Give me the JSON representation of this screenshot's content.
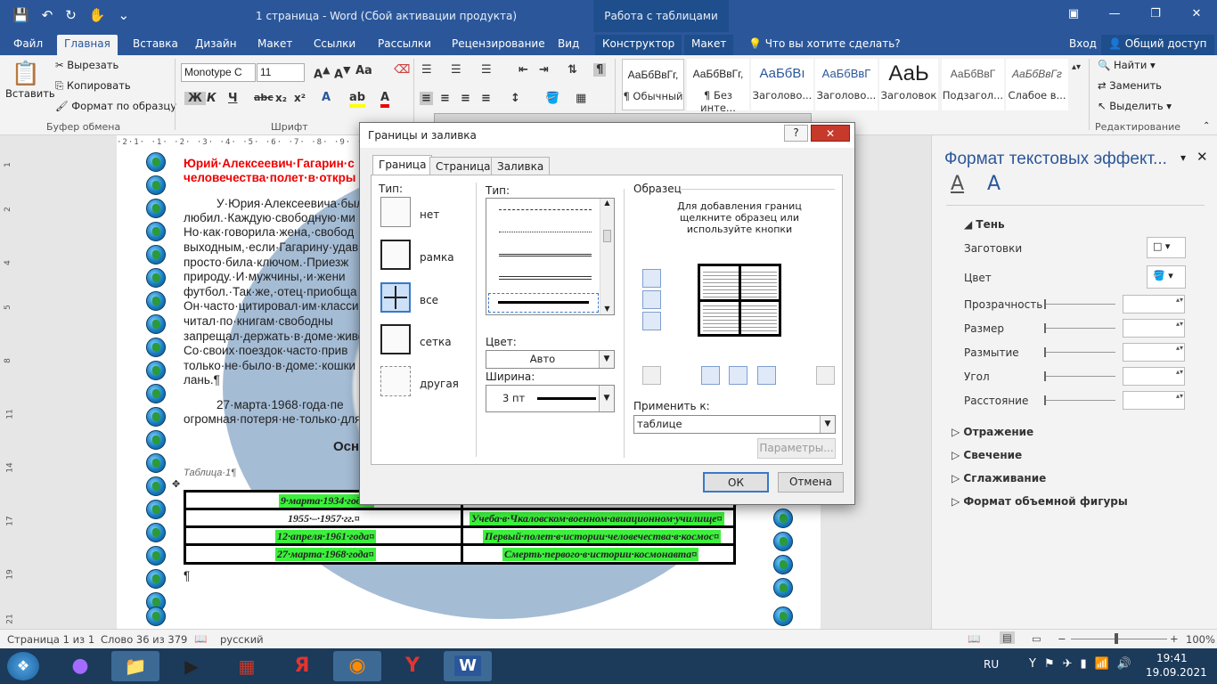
{
  "window": {
    "title": "1 страница - Word (Сбой активации продукта)",
    "context_title": "Работа с таблицами",
    "login": "Вход",
    "share": "Общий доступ"
  },
  "tabs": [
    "Файл",
    "Главная",
    "Вставка",
    "Дизайн",
    "Макет",
    "Ссылки",
    "Рассылки",
    "Рецензирование",
    "Вид",
    "Конструктор",
    "Макет"
  ],
  "tell_me": "Что вы хотите сделать?",
  "ribbon": {
    "paste": "Вставить",
    "cut": "Вырезать",
    "copy": "Копировать",
    "format_painter": "Формат по образцу",
    "clipboard_group": "Буфер обмена",
    "font_name": "Monotype C",
    "font_size": "11",
    "font_group": "Шрифт",
    "styles": [
      {
        "preview": "АаБбВвГг,",
        "name": "¶ Обычный"
      },
      {
        "preview": "АаБбВвГг,",
        "name": "¶ Без инте..."
      },
      {
        "preview": "АаБбВı",
        "name": "Заголово..."
      },
      {
        "preview": "АаБбВвГ",
        "name": "Заголово..."
      },
      {
        "preview": "АаЬ",
        "name": "Заголовок"
      },
      {
        "preview": "АаБбВвГ",
        "name": "Подзагол..."
      },
      {
        "preview": "АаБбВвГг",
        "name": "Слабое в..."
      }
    ],
    "find": "Найти",
    "replace": "Заменить",
    "select": "Выделить",
    "editing_group": "Редактирование"
  },
  "document": {
    "heading_line1": "Юрий·Алексеевич·Гагарин·с",
    "heading_line2": "человечества·полет·в·откры",
    "lines": [
      "У·Юрия·Алексеевича·был",
      "любил.·Каждую·свободную·ми",
      "Но·как·говорила·жена,·свобод",
      "выходным,·если·Гагарину·удав",
      "просто·била·ключом.·Приезж",
      "природу.·И·мужчины,·и·жени",
      "футбол.·Так·же,·отец·приобща",
      "Он·часто·цитировал·им·класси",
      "читал·по·книгам·свободны",
      "запрещал·держать·в·доме·живо",
      "Со·своих·поездок·часто·прив",
      "только·не·было·в·доме:·кошки",
      "лань.¶"
    ],
    "para2_line1": "27·марта·1968·года·пе",
    "para2_line2": "огромная·потеря·не·только·для",
    "table_heading": "Осн",
    "table_caption": "Таблица·1¶",
    "table_rows": [
      {
        "date": "9·марта·1934·года¤",
        "event": ""
      },
      {
        "date": "1955·–·1957·гг.¤",
        "event": "Учеба·в·Чкаловском·военном·авиационном·училище¤"
      },
      {
        "date": "12·апреля·1961·года¤",
        "event": "Первый·полет·в·истории·человечества·в·космос¤"
      },
      {
        "date": "27·марта·1968·года¤",
        "event": "Смерть·первого·в·истории·космонавта¤"
      }
    ],
    "end_mark": "¶"
  },
  "pane": {
    "title": "Формат текстовых эффект...",
    "section_shadow": "Тень",
    "props": [
      "Заготовки",
      "Цвет",
      "Прозрачность",
      "Размер",
      "Размытие",
      "Угол",
      "Расстояние"
    ],
    "sections": [
      "Отражение",
      "Свечение",
      "Сглаживание",
      "Формат объемной фигуры"
    ]
  },
  "dialog": {
    "title": "Границы и заливка",
    "tabs": [
      "Граница",
      "Страница",
      "Заливка"
    ],
    "type_label": "Тип:",
    "types": [
      "нет",
      "рамка",
      "все",
      "сетка",
      "другая"
    ],
    "style_label": "Тип:",
    "color_label": "Цвет:",
    "color_value": "Авто",
    "width_label": "Ширина:",
    "width_value": "3 пт",
    "sample_label": "Образец",
    "sample_hint": "Для добавления границ щелкните образец или используйте кнопки",
    "apply_label": "Применить к:",
    "apply_value": "таблице",
    "params": "Параметры...",
    "ok": "ОК",
    "cancel": "Отмена"
  },
  "status": {
    "page": "Страница 1 из 1",
    "words": "Слово 36 из 379",
    "lang": "русский",
    "zoom": "100%"
  },
  "taskbar": {
    "lang": "RU",
    "time": "19:41",
    "date": "19.09.2021"
  }
}
